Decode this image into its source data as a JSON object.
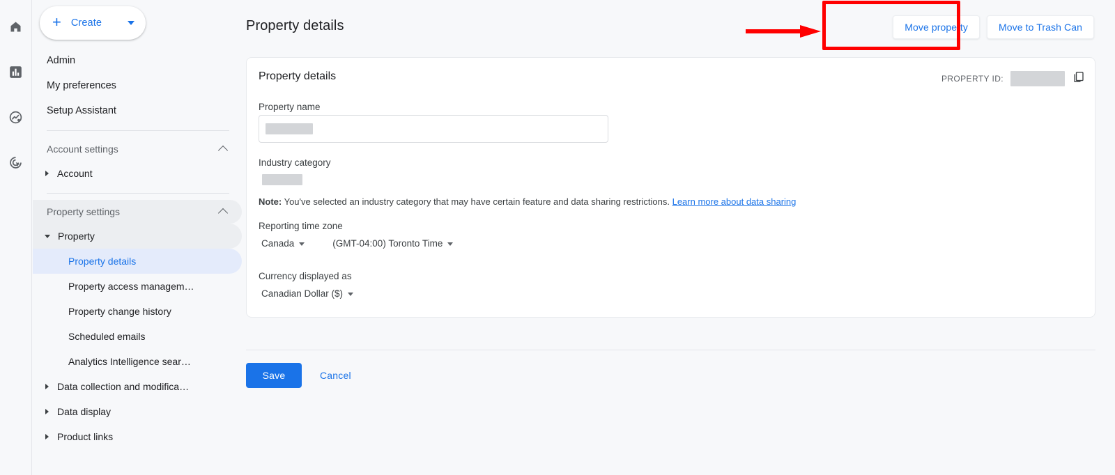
{
  "rail": {
    "icons": [
      {
        "name": "home-icon",
        "title": "Home"
      },
      {
        "name": "reports-bar-chart-icon",
        "title": "Reports"
      },
      {
        "name": "explore-trend-icon",
        "title": "Explore"
      },
      {
        "name": "advertising-target-icon",
        "title": "Advertising"
      }
    ]
  },
  "sidebar": {
    "create_button": {
      "label": "Create",
      "plus": "+",
      "caret": "chevron-down-icon"
    },
    "top_items": [
      {
        "label": "Admin",
        "name": "sidebar-item-admin"
      },
      {
        "label": "My preferences",
        "name": "sidebar-item-my-preferences"
      },
      {
        "label": "Setup Assistant",
        "name": "sidebar-item-setup-assistant"
      }
    ],
    "account_settings": {
      "label": "Account settings",
      "expanded": true
    },
    "account": {
      "label": "Account",
      "expanded": false
    },
    "property_settings": {
      "label": "Property settings",
      "expanded": true
    },
    "property": {
      "label": "Property",
      "expanded": true
    },
    "property_children": [
      {
        "label": "Property details",
        "name": "sidebar-item-property-details",
        "active": true
      },
      {
        "label": "Property access managem…",
        "name": "sidebar-item-property-access-management",
        "active": false
      },
      {
        "label": "Property change history",
        "name": "sidebar-item-property-change-history",
        "active": false
      },
      {
        "label": "Scheduled emails",
        "name": "sidebar-item-scheduled-emails",
        "active": false
      },
      {
        "label": "Analytics Intelligence sear…",
        "name": "sidebar-item-analytics-intelligence-search",
        "active": false
      }
    ],
    "collapsed_groups": [
      {
        "label": "Data collection and modifica…",
        "name": "sidebar-item-data-collection-and-modification"
      },
      {
        "label": "Data display",
        "name": "sidebar-item-data-display"
      },
      {
        "label": "Product links",
        "name": "sidebar-item-product-links"
      }
    ]
  },
  "header": {
    "title": "Property details",
    "move_property_label": "Move property",
    "move_to_trash_label": "Move to Trash Can"
  },
  "card": {
    "title": "Property details",
    "property_id_label": "PROPERTY ID:",
    "property_id_value": "",
    "copy_icon": "copy-icon",
    "property_name_label": "Property name",
    "property_name_value": "",
    "industry_category_label": "Industry category",
    "industry_category_value": "",
    "note_prefix": "Note:",
    "note_text": " You've selected an industry category that may have certain feature and data sharing restrictions. ",
    "note_link": "Learn more about data sharing",
    "timezone_label": "Reporting time zone",
    "timezone_country": "Canada",
    "timezone_zone": "(GMT-04:00) Toronto Time",
    "currency_label": "Currency displayed as",
    "currency_value": "Canadian Dollar ($)"
  },
  "footer": {
    "save_label": "Save",
    "cancel_label": "Cancel"
  },
  "annotation": {
    "highlight_color": "#ff0000",
    "target": "Move property",
    "shapes": [
      "arrow-right",
      "rectangle-highlight"
    ]
  },
  "colors": {
    "accent": "#1a73e8",
    "page_bg": "#f7f8fa",
    "card_bg": "#ffffff",
    "active_nav_bg": "#e4ebfb",
    "redaction": "#d3d5d8"
  }
}
